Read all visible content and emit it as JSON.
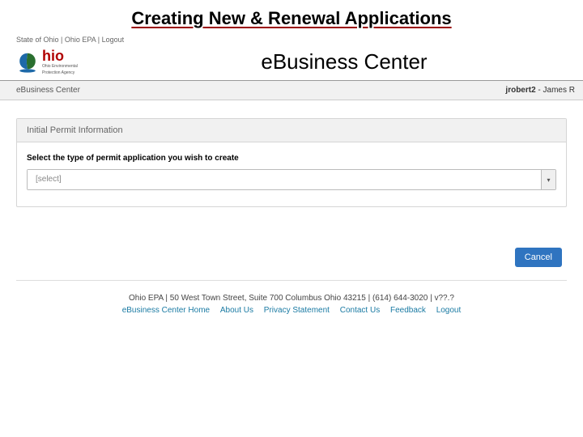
{
  "slide": {
    "title": "Creating New & Renewal Applications"
  },
  "topbar": {
    "state_link": "State of Ohio",
    "sep1": " | ",
    "epa_link": "Ohio EPA",
    "sep2": " | ",
    "logout_link": "Logout"
  },
  "header": {
    "logo_wordmark": "hio",
    "logo_sub1": "Ohio Environmental",
    "logo_sub2": "Protection Agency",
    "app_title": "eBusiness Center"
  },
  "navbar": {
    "breadcrumb": "eBusiness Center",
    "user_id": "jrobert2",
    "user_name": " - James R"
  },
  "panel": {
    "header": "Initial Permit Information",
    "label": "Select the type of permit application you wish to create",
    "select_placeholder": "[select]"
  },
  "buttons": {
    "cancel": "Cancel"
  },
  "footer": {
    "address": "Ohio EPA | 50 West Town Street, Suite 700 Columbus Ohio 43215 | (614) 644-3020 | v??.?",
    "links": {
      "home": "eBusiness Center Home",
      "about": "About Us",
      "privacy": "Privacy Statement",
      "contact": "Contact Us",
      "feedback": "Feedback",
      "logout": "Logout"
    }
  }
}
